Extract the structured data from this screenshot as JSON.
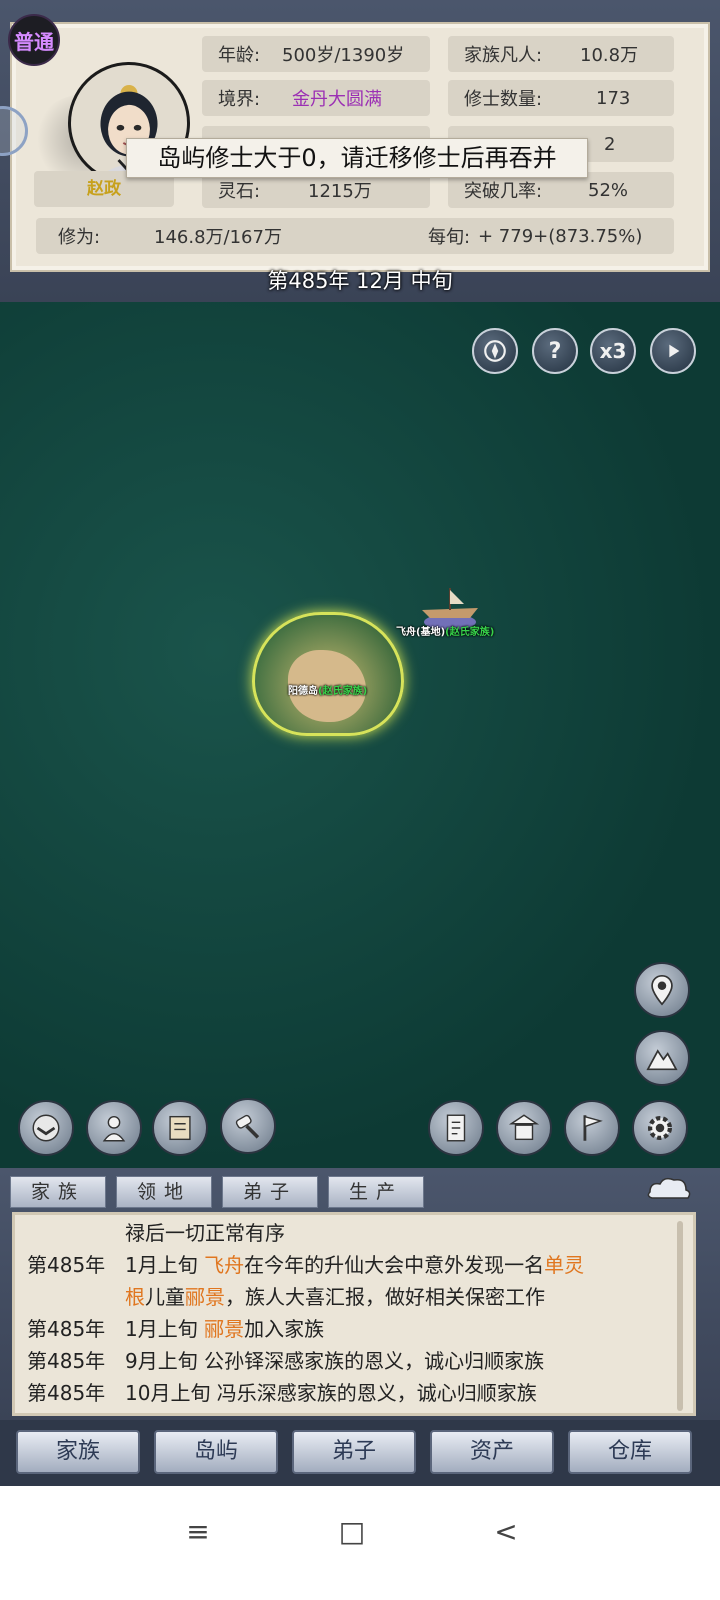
{
  "status": {
    "mode_badge": "普通",
    "leader_name": "赵政",
    "age_label": "年龄:",
    "age_value": "500岁/1390岁",
    "family_mortals_label": "家族凡人:",
    "family_mortals_value": "10.8万",
    "realm_label": "境界:",
    "realm_value": "金丹大圆满",
    "cultivators_label": "修士数量:",
    "cultivators_value": "173",
    "hidden_row_value": "2",
    "spirit_stone_label": "灵石:",
    "spirit_stone_value": "1215万",
    "breakthrough_label": "突破几率:",
    "breakthrough_value": "52%",
    "cultivation_label": "修为:",
    "cultivation_value": "146.8万/167万",
    "per_period_label": "每旬:",
    "per_period_value": "+ 779+(873.75%)",
    "toast": "岛屿修士大于0，请迁移修士后再吞并",
    "date": "第485年 12月 中旬"
  },
  "map": {
    "speed_label": "x3",
    "help_label": "?",
    "island_name": "阳德岛",
    "island_family": "(赵氏家族)",
    "airship_name": "飞舟(基地)",
    "airship_family": "(赵氏家族)"
  },
  "log": {
    "tabs": [
      "家族",
      "领地",
      "弟子",
      "生产"
    ],
    "lines": [
      {
        "year": "",
        "text": "禄后一切正常有序"
      },
      {
        "year": "第485年",
        "pre": "1月上旬 ",
        "hl1": "飞舟",
        "mid": "在今年的升仙大会中意外发现一名",
        "hl2": "单灵"
      },
      {
        "year": "",
        "hl1": "根",
        "mid": "儿童",
        "hl2": "郦景",
        "post": "，族人大喜汇报，做好相关保密工作"
      },
      {
        "year": "第485年",
        "pre": "1月上旬 ",
        "hl1": "郦景",
        "post": "加入家族"
      },
      {
        "year": "第485年",
        "text": "9月上旬 公孙铎深感家族的恩义，诚心归顺家族"
      },
      {
        "year": "第485年",
        "text": "10月上旬 冯乐深感家族的恩义，诚心归顺家族"
      }
    ]
  },
  "nav": {
    "family": "家族",
    "island": "岛屿",
    "disciple": "弟子",
    "assets": "资产",
    "warehouse": "仓库"
  },
  "system": {
    "menu_icon": "≡",
    "home_icon": "□",
    "back_icon": "<"
  },
  "colors": {
    "map_sea": "#0f3d38",
    "highlight_text": "#e0761f",
    "realm_text": "#9b2fb4",
    "family_tag": "#37d24a"
  }
}
